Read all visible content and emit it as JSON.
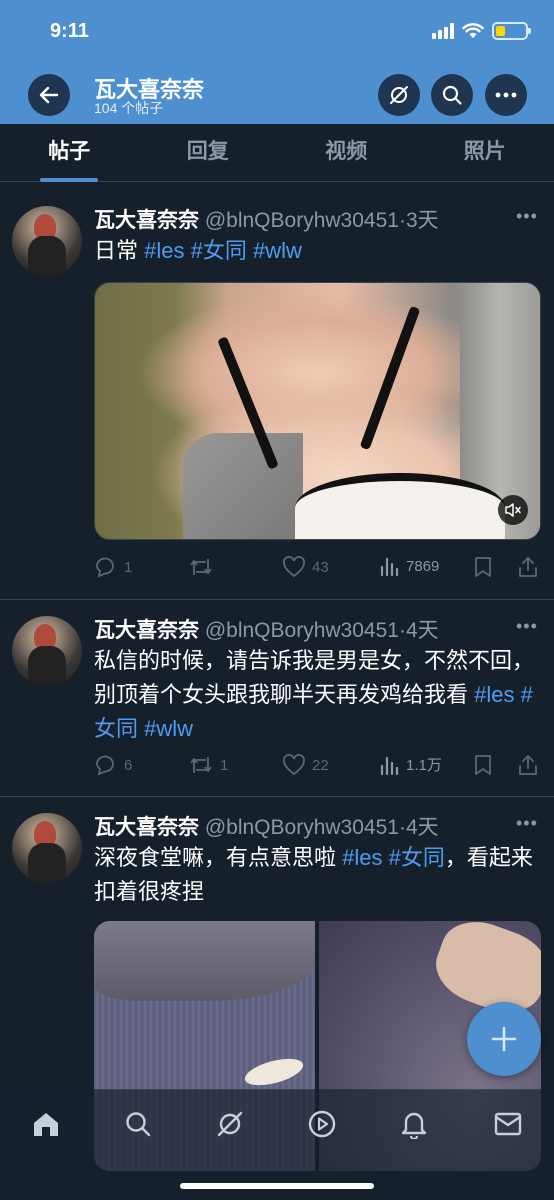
{
  "status_bar": {
    "time": "9:11"
  },
  "header": {
    "title": "瓦大喜奈奈",
    "subtitle": "104 个帖子",
    "icons": [
      "back-arrow-icon",
      "topics-icon",
      "search-icon",
      "more-icon"
    ]
  },
  "tabs": [
    {
      "label": "帖子",
      "active": true
    },
    {
      "label": "回复",
      "active": false
    },
    {
      "label": "视频",
      "active": false
    },
    {
      "label": "照片",
      "active": false
    }
  ],
  "posts": [
    {
      "name": "瓦大喜奈奈",
      "handle": "@blnQBoryhw30451",
      "time": "·3天",
      "text": "日常 ",
      "tags": [
        "#les",
        "#女同",
        "#wlw"
      ],
      "replies": "1",
      "retweets": "",
      "likes": "43",
      "views": "7869",
      "media": "video"
    },
    {
      "name": "瓦大喜奈奈",
      "handle": "@blnQBoryhw30451",
      "time": "·4天",
      "text": "私信的时候，请告诉我是男是女，不然不回，别顶着个女头跟我聊半天再发鸡给我看 ",
      "tags": [
        "#les",
        "#女同",
        "#wlw"
      ],
      "replies": "6",
      "retweets": "1",
      "likes": "22",
      "views": "1.1万"
    },
    {
      "name": "瓦大喜奈奈",
      "handle": "@blnQBoryhw30451",
      "time": "·4天",
      "text_before": "深夜食堂嘛，有点意思啦 ",
      "tags": [
        "#les",
        "#女同"
      ],
      "text_after": "，看起来扣着很疼捏",
      "media": "two-photos"
    }
  ],
  "fab": {
    "icon": "plus-icon"
  },
  "bottom_nav": [
    "home-icon",
    "search-icon",
    "topics-icon",
    "spaces-icon",
    "notifications-icon",
    "messages-icon"
  ],
  "colors": {
    "brand": "#4e8fd0",
    "background": "#15202b",
    "link": "#4e9cf0",
    "muted": "#8b98a5"
  }
}
